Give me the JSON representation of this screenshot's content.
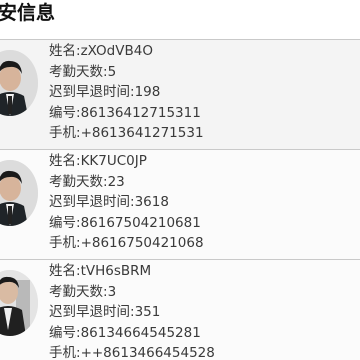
{
  "header": {
    "title": "安信息"
  },
  "labels": {
    "name": "姓名:",
    "attendance": "考勤天数:",
    "late": "迟到早退时间:",
    "id": "编号:",
    "phone": "手机:"
  },
  "records": [
    {
      "name": "zXOdVB4O",
      "attendance": "5",
      "late": "198",
      "id": "86136412715311",
      "phone": "+8613641271531"
    },
    {
      "name": "KK7UC0JP",
      "attendance": "23",
      "late": "3618",
      "id": "86167504210681",
      "phone": "+8616750421068"
    },
    {
      "name": "tVH6sBRM",
      "attendance": "3",
      "late": "351",
      "id": "86134664545281",
      "phone": "++8613466454528"
    }
  ],
  "icons": {
    "avatar": "person-photo"
  }
}
